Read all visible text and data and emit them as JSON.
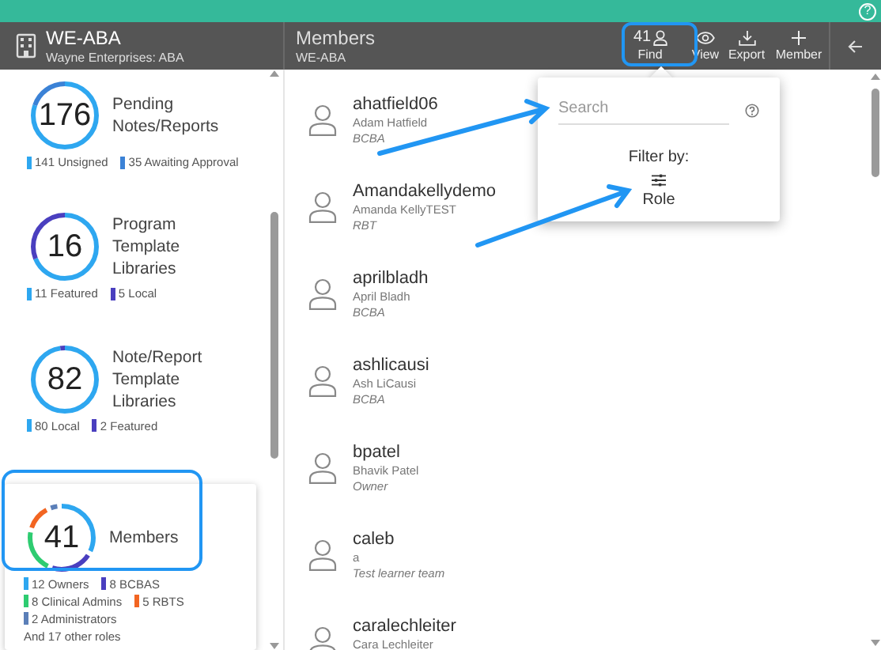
{
  "help_icon": "?",
  "org": {
    "title": "WE-ABA",
    "subtitle": "Wayne Enterprises: ABA"
  },
  "page": {
    "title": "Members",
    "subtitle": "WE-ABA"
  },
  "toolbar": [
    {
      "kind": "find",
      "count": "41",
      "label": "Find"
    },
    {
      "kind": "view",
      "label": "View"
    },
    {
      "kind": "export",
      "label": "Export"
    },
    {
      "kind": "add",
      "label": "Member"
    }
  ],
  "sidebar": {
    "cards": [
      {
        "number": "176",
        "title": "Pending Notes/Reports",
        "selected": false,
        "legend": [
          {
            "label": "141 Unsigned",
            "color": "#2ea7f0"
          },
          {
            "label": "35 Awaiting Approval",
            "color": "#3b82d6"
          }
        ]
      },
      {
        "number": "16",
        "title": "Program Template Libraries",
        "selected": false,
        "legend": [
          {
            "label": "11 Featured",
            "color": "#2ea7f0"
          },
          {
            "label": "5 Local",
            "color": "#4a3fbf"
          }
        ]
      },
      {
        "number": "82",
        "title": "Note/Report Template Libraries",
        "selected": false,
        "legend": [
          {
            "label": "80 Local",
            "color": "#2ea7f0"
          },
          {
            "label": "2 Featured",
            "color": "#4a3fbf"
          }
        ]
      },
      {
        "number": "41",
        "title": "Members",
        "selected": true,
        "legend": [
          {
            "label": "12 Owners",
            "color": "#2ea7f0"
          },
          {
            "label": "8 BCBAS",
            "color": "#4a3fbf"
          },
          {
            "label": "8 Clinical Admins",
            "color": "#2ecc71"
          },
          {
            "label": "5 RBTS",
            "color": "#f26522"
          },
          {
            "label": "2 Administrators",
            "color": "#5b7fb8"
          }
        ],
        "note": "And 17 other roles"
      }
    ]
  },
  "members": [
    {
      "username": "ahatfield06",
      "name": "Adam Hatfield",
      "role": "BCBA"
    },
    {
      "username": "Amandakellydemo",
      "name": "Amanda KellyTEST",
      "role": "RBT"
    },
    {
      "username": "aprilbladh",
      "name": "April Bladh",
      "role": "BCBA"
    },
    {
      "username": "ashlicausi",
      "name": "Ash LiCausi",
      "role": "BCBA"
    },
    {
      "username": "bpatel",
      "name": "Bhavik Patel",
      "role": "Owner"
    },
    {
      "username": "caleb",
      "name": "a",
      "role": "Test learner team"
    },
    {
      "username": "caralechleiter",
      "name": "Cara Lechleiter"
    }
  ],
  "popover": {
    "search": {
      "placeholder": "Search"
    },
    "filter_label": "Filter by:",
    "filters": [
      "Role"
    ]
  }
}
